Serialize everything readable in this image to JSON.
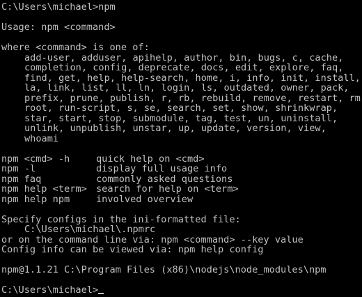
{
  "prompt_cmd": "C:\\Users\\michael>npm",
  "usage": "Usage: npm <command>",
  "where_header": "where <command> is one of:",
  "command_list": [
    "add-user, adduser, apihelp, author, bin, bugs, c, cache,",
    "completion, config, deprecate, docs, edit, explore, faq,",
    "find, get, help, help-search, home, i, info, init, install,",
    "la, link, list, ll, ln, login, ls, outdated, owner, pack,",
    "prefix, prune, publish, r, rb, rebuild, remove, restart, rm,",
    "root, run-script, s, se, search, set, show, shrinkwrap,",
    "star, start, stop, submodule, tag, test, un, uninstall,",
    "unlink, unpublish, unstar, up, update, version, view,",
    "whoami"
  ],
  "help_rows": [
    {
      "cmd": "npm <cmd> -h",
      "desc": "quick help on <cmd>"
    },
    {
      "cmd": "npm -l",
      "desc": "display full usage info"
    },
    {
      "cmd": "npm faq",
      "desc": "commonly asked questions"
    },
    {
      "cmd": "npm help <term>",
      "desc": "search for help on <term>"
    },
    {
      "cmd": "npm help npm",
      "desc": "involved overview"
    }
  ],
  "config_header": "Specify configs in the ini-formatted file:",
  "config_path": "C:\\Users\\michael\\.npmrc",
  "config_cmdline": "or on the command line via: npm <command> --key value",
  "config_info": "Config info can be viewed via: npm help config",
  "version_line": "npm@1.1.21 C:\\Program Files (x86)\\nodejs\\node_modules\\npm",
  "final_prompt": "C:\\Users\\michael>",
  "colors": {
    "background": "#000000",
    "text": "#c0c0c0"
  }
}
